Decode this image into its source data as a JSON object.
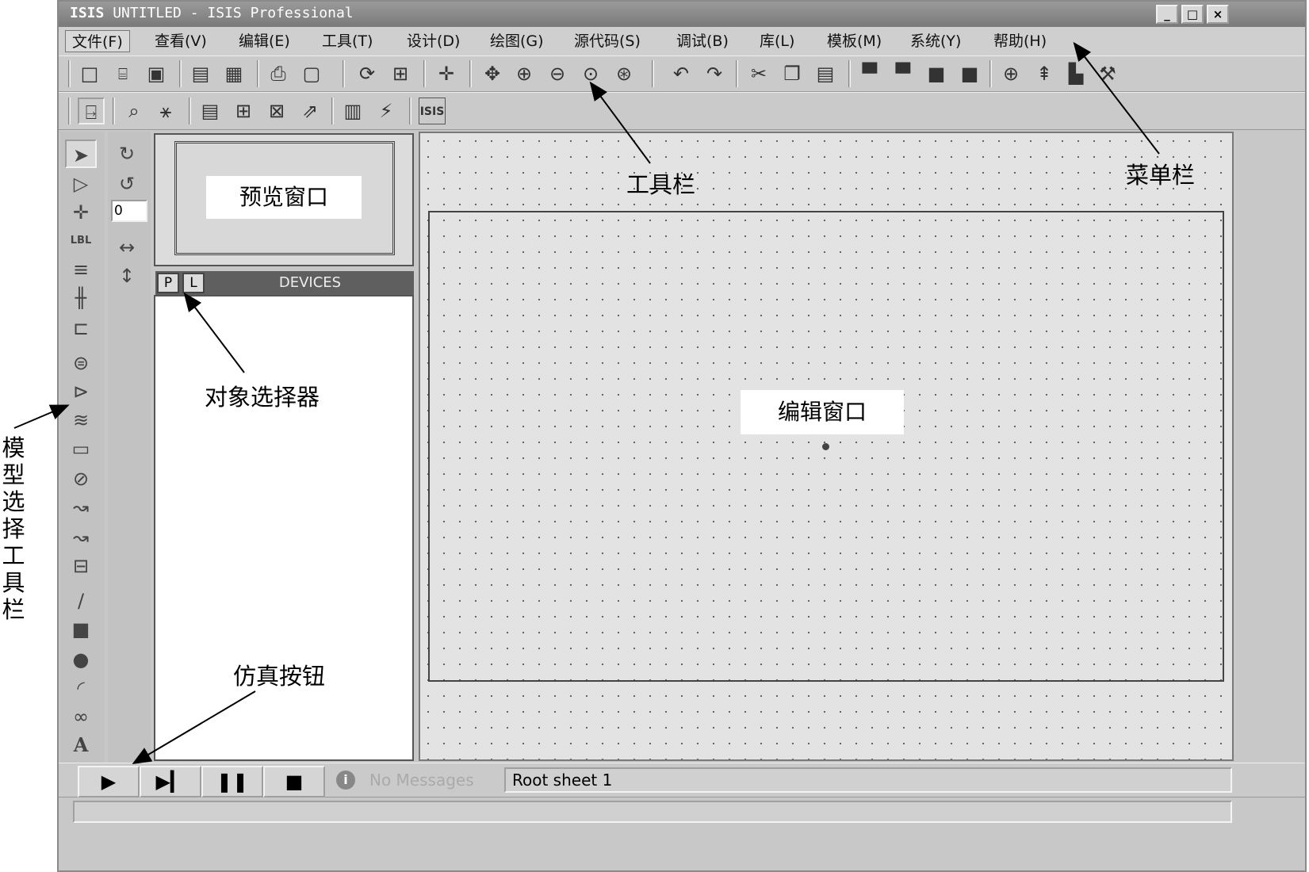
{
  "window": {
    "app_logo": "ISIS",
    "title": " UNTITLED - ISIS Professional",
    "min_label": "_",
    "max_label": "□",
    "close_label": "×"
  },
  "menu": [
    {
      "label": "文件(F)"
    },
    {
      "label": "查看(V)"
    },
    {
      "label": "编辑(E)"
    },
    {
      "label": "工具(T)"
    },
    {
      "label": "设计(D)"
    },
    {
      "label": "绘图(G)"
    },
    {
      "label": "源代码(S)"
    },
    {
      "label": "调试(B)"
    },
    {
      "label": "库(L)"
    },
    {
      "label": "模板(M)"
    },
    {
      "label": "系统(Y)"
    },
    {
      "label": "帮助(H)"
    }
  ],
  "left_panel": {
    "rotation_value": "0",
    "p_button": "P",
    "l_button": "L",
    "devices_header": "DEVICES"
  },
  "annotations": {
    "preview": "预览窗口",
    "toolbar": "工具栏",
    "menubar": "菜单栏",
    "object_selector": "对象选择器",
    "editor": "编辑窗口",
    "model_toolbar": "模型选择工具栏",
    "sim_buttons": "仿真按钮"
  },
  "simulation": {
    "play": "▶",
    "step": "▶▎",
    "pause": "❚❚",
    "stop": "■"
  },
  "status": {
    "messages": "No Messages",
    "sheet": "Root sheet 1",
    "info_icon": "i"
  },
  "icons": {
    "new": "□",
    "open": "📂",
    "save": "💾",
    "pointer": "➤",
    "component": "▷",
    "junction": "✛",
    "rotate_cw": "↻",
    "rotate_ccw": "↺",
    "flip_h": "↔",
    "flip_v": "↕",
    "line": "/",
    "box": "■",
    "circle": "●",
    "arc": "◜",
    "path": "∞",
    "text": "A"
  }
}
